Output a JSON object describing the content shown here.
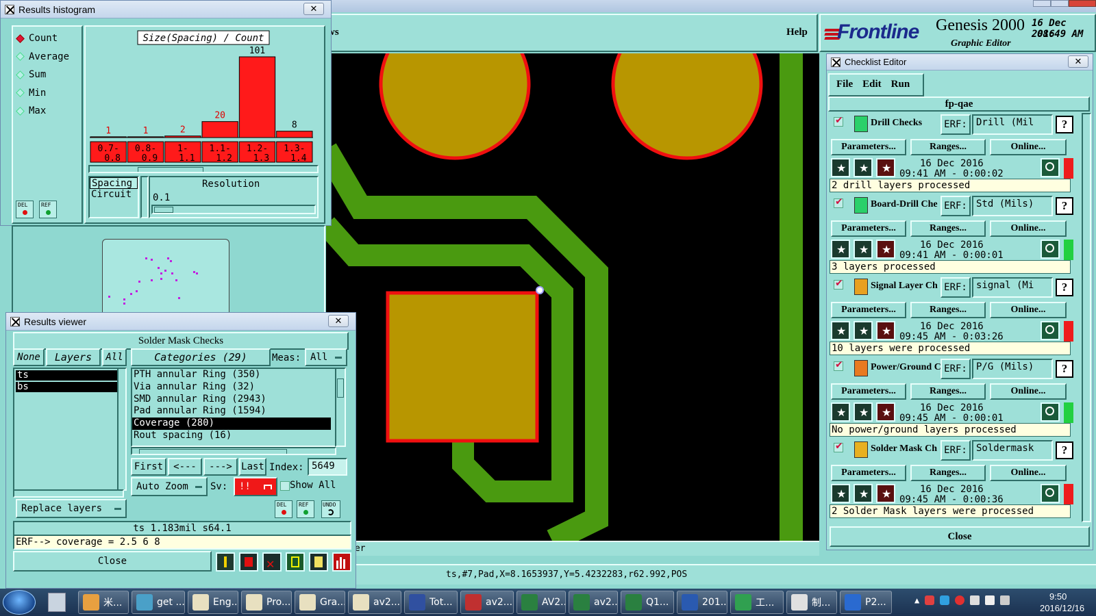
{
  "main_menu": {
    "windows_fragment": "ws",
    "help": "Help"
  },
  "brand": {
    "logo": "Frontline",
    "product": "Genesis 2000",
    "subtitle": "Graphic Editor",
    "date": "16 Dec 2016",
    "time": "08:49 AM"
  },
  "status_line": "ts,#7,Pad,X=8.1653937,Y=5.4232283,r62.992,POS",
  "lower_fragment": "mer",
  "histogram": {
    "title": "Results histogram",
    "modes": [
      {
        "label": "Count",
        "selected": true
      },
      {
        "label": "Average",
        "selected": false
      },
      {
        "label": "Sum",
        "selected": false
      },
      {
        "label": "Min",
        "selected": false
      },
      {
        "label": "Max",
        "selected": false
      }
    ],
    "del_label": "DEL",
    "ref_label": "REF",
    "attr_list": [
      "Spacing",
      "Circuit"
    ],
    "resolution_label": "Resolution",
    "resolution_value": "0.1"
  },
  "chart_data": {
    "type": "bar",
    "title": "Size(Spacing) / Count",
    "categories": [
      [
        "0.7-",
        "0.8"
      ],
      [
        "0.8-",
        "0.9"
      ],
      [
        "1-",
        "1.1"
      ],
      [
        "1.1-",
        "1.2"
      ],
      [
        "1.2-",
        "1.3"
      ],
      [
        "1.3-",
        "1.4"
      ]
    ],
    "values": [
      1,
      1,
      2,
      20,
      101,
      8
    ],
    "ylim": [
      0,
      101
    ],
    "bar_color": "#ff1a1a"
  },
  "viewer": {
    "title": "Results viewer",
    "header": "Solder Mask Checks",
    "none_label": "None",
    "layers_label": "Layers",
    "all_label": "All",
    "layers": [
      "ts",
      "bs"
    ],
    "categories_label": "Categories (29)",
    "meas_label": "Meas:",
    "meas_value": "All",
    "categories": [
      {
        "label": "PTH annular Ring (350)",
        "selected": false
      },
      {
        "label": "Via annular Ring (32)",
        "selected": false
      },
      {
        "label": "SMD annular Ring (2943)",
        "selected": false
      },
      {
        "label": "Pad annular Ring (1594)",
        "selected": false
      },
      {
        "label": "Coverage (280)",
        "selected": true
      },
      {
        "label": "Rout spacing (16)",
        "selected": false
      }
    ],
    "nav": {
      "first": "First",
      "prev": "<---",
      "next": "--->",
      "last": "Last",
      "index_label": "Index:",
      "index_value": "5649"
    },
    "auto_zoom": "Auto Zoom",
    "sv_label": "Sv:",
    "sv_value": "!!",
    "show_all": "Show All",
    "replace_layers": "Replace layers",
    "del": "DEL",
    "ref": "REF",
    "undo": "UNDO",
    "info": "ts 1.183mil    s64.1",
    "erf_line": "ERF--> coverage = 2.5 6 8",
    "close": "Close"
  },
  "checklist": {
    "title": "Checklist Editor",
    "menu": [
      "File",
      "Edit",
      "Run"
    ],
    "name": "fp-qae",
    "erf_label": "ERF:",
    "help": "?",
    "params": "Parameters...",
    "ranges": "Ranges...",
    "online": "Online...",
    "close": "Close",
    "checks": [
      {
        "name": "Drill Checks",
        "erf": "Drill (Mil",
        "date": "16 Dec 2016",
        "time": "09:41 AM - 0:00:02",
        "status": "2 drill layers processed",
        "state_color": "#ee1c1c",
        "icon_color": "#2ad06a"
      },
      {
        "name": "Board-Drill Che",
        "erf": "Std (Mils)",
        "date": "16 Dec 2016",
        "time": "09:41 AM - 0:00:01",
        "status": "3 layers processed",
        "state_color": "#22d040",
        "icon_color": "#2ad06a"
      },
      {
        "name": "Signal Layer Ch",
        "erf": "signal (Mi",
        "date": "16 Dec 2016",
        "time": "09:45 AM - 0:03:26",
        "status": "10 layers were processed",
        "state_color": "#ee1c1c",
        "icon_color": "#e8a020"
      },
      {
        "name": "Power/Ground C",
        "erf": "P/G (Mils)",
        "date": "16 Dec 2016",
        "time": "09:45 AM - 0:00:01",
        "status": "No power/ground layers processed",
        "state_color": "#22d040",
        "icon_color": "#e87a20"
      },
      {
        "name": "Solder Mask Ch",
        "erf": "Soldermask",
        "date": "16 Dec 2016",
        "time": "09:45 AM - 0:00:36",
        "status": "2 Solder Mask layers were processed",
        "state_color": "#ee1c1c",
        "icon_color": "#e8b020"
      }
    ]
  },
  "taskbar": {
    "items": [
      {
        "label": "米...",
        "color": "#e8a040"
      },
      {
        "label": "get ...",
        "color": "#4aa0c8"
      },
      {
        "label": "Eng...",
        "color": "#e8e0c0"
      },
      {
        "label": "Pro...",
        "color": "#e8e0c0"
      },
      {
        "label": "Gra...",
        "color": "#e8e0c0"
      },
      {
        "label": "av2...",
        "color": "#e8e0c0"
      },
      {
        "label": "Tot...",
        "color": "#3050a0"
      },
      {
        "label": "av2...",
        "color": "#c03030"
      },
      {
        "label": "AV2...",
        "color": "#2a8040"
      },
      {
        "label": "av2...",
        "color": "#2a8040"
      },
      {
        "label": "Q1...",
        "color": "#2a8040"
      },
      {
        "label": "201...",
        "color": "#2a5ab0"
      },
      {
        "label": "工...",
        "color": "#30a050"
      },
      {
        "label": "制...",
        "color": "#e0e0e0"
      },
      {
        "label": "P2...",
        "color": "#2a6ad0"
      }
    ],
    "clock_time": "9:50",
    "clock_date": "2016/12/16"
  }
}
